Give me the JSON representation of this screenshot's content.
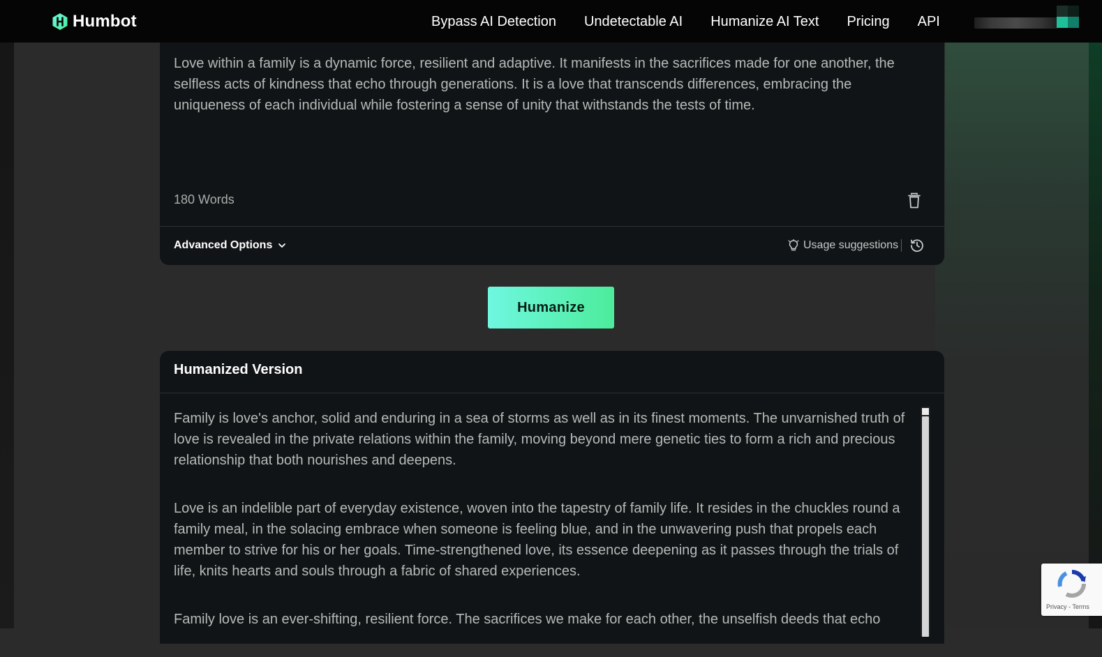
{
  "header": {
    "brand": "Humbot",
    "nav": [
      {
        "label": "Bypass AI Detection"
      },
      {
        "label": "Undetectable AI"
      },
      {
        "label": "Humanize AI Text"
      },
      {
        "label": "Pricing"
      },
      {
        "label": "API"
      }
    ]
  },
  "input_card": {
    "text": "Love within a family is a dynamic force, resilient and adaptive. It manifests in the sacrifices made for one another, the selfless acts of kindness that echo through generations. It is a love that transcends differences, embracing the uniqueness of each individual while fostering a sense of unity that withstands the tests of time.",
    "word_count": "180 Words",
    "advanced_options_label": "Advanced Options",
    "usage_suggestions_label": "Usage suggestions"
  },
  "humanize_button": {
    "label": "Humanize"
  },
  "output_card": {
    "title": "Humanized Version",
    "paragraphs": [
      "Family is love's anchor, solid and enduring in a sea of storms as well as in its finest moments. The unvarnished truth of love is revealed in the private relations within the family, moving beyond mere genetic ties to form a rich and precious relationship that both nourishes and deepens.",
      "Love is an indelible part of everyday existence, woven into the tapestry of family life. It resides in the chuckles round a family meal, in the solacing embrace when someone is feeling blue, and in the unwavering push that propels each member to strive for his or her goals. Time-strengthened love, its essence deepening as it passes through the trials of life, knits hearts and souls through a fabric of shared experiences.",
      "Family love is an ever-shifting, resilient force. The sacrifices we make for each other, the unselfish deeds that echo"
    ]
  },
  "recaptcha": {
    "privacy": "Privacy",
    "separator": " - ",
    "terms": "Terms"
  },
  "colors": {
    "accent_start": "#6ff7e0",
    "accent_end": "#4cec9b",
    "header_bg": "#050505",
    "card_bg": "#111416"
  },
  "icons": {
    "logo": "humbot-logo-icon",
    "trash": "trash-icon",
    "advanced_chevron": "chevron-down-icon",
    "usage": "lightbulb-icon",
    "history": "history-icon"
  }
}
